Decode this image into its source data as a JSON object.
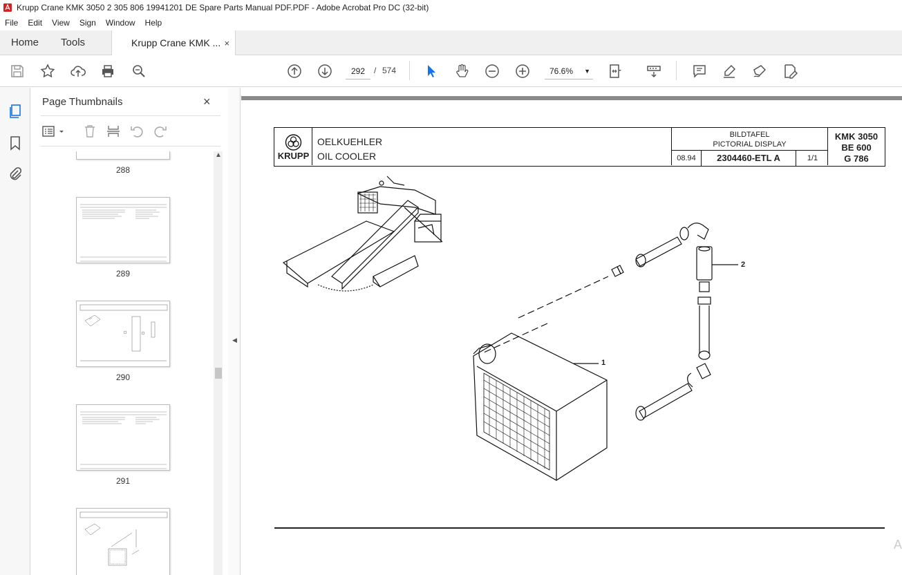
{
  "window": {
    "title": "Krupp Crane KMK 3050 2 305 806 19941201 DE Spare Parts Manual PDF.PDF - Adobe Acrobat Pro DC (32-bit)"
  },
  "menu": [
    "File",
    "Edit",
    "View",
    "Sign",
    "Window",
    "Help"
  ],
  "tabs": {
    "home": "Home",
    "tools": "Tools",
    "document": "Krupp Crane KMK ...",
    "close": "×"
  },
  "toolbar": {
    "current_page": "292",
    "page_sep": "/",
    "total_pages": "574",
    "zoom": "76.6%"
  },
  "panel": {
    "title": "Page Thumbnails",
    "close": "×",
    "thumbnails": [
      {
        "label": "288"
      },
      {
        "label": "289"
      },
      {
        "label": "290"
      },
      {
        "label": "291"
      },
      {
        "label": ""
      }
    ]
  },
  "doc": {
    "logo_text": "KRUPP",
    "title_de": "OELKUEHLER",
    "title_en": "OIL COOLER",
    "bild_de": "BILDTAFEL",
    "bild_en": "PICTORIAL DISPLAY",
    "date": "08.94",
    "part_no": "2304460-ETL  A",
    "sheet": "1/1",
    "model": "KMK 3050",
    "be": "BE 600",
    "g": "G 786",
    "callout1": "1",
    "callout2": "2"
  },
  "watermark": "A"
}
